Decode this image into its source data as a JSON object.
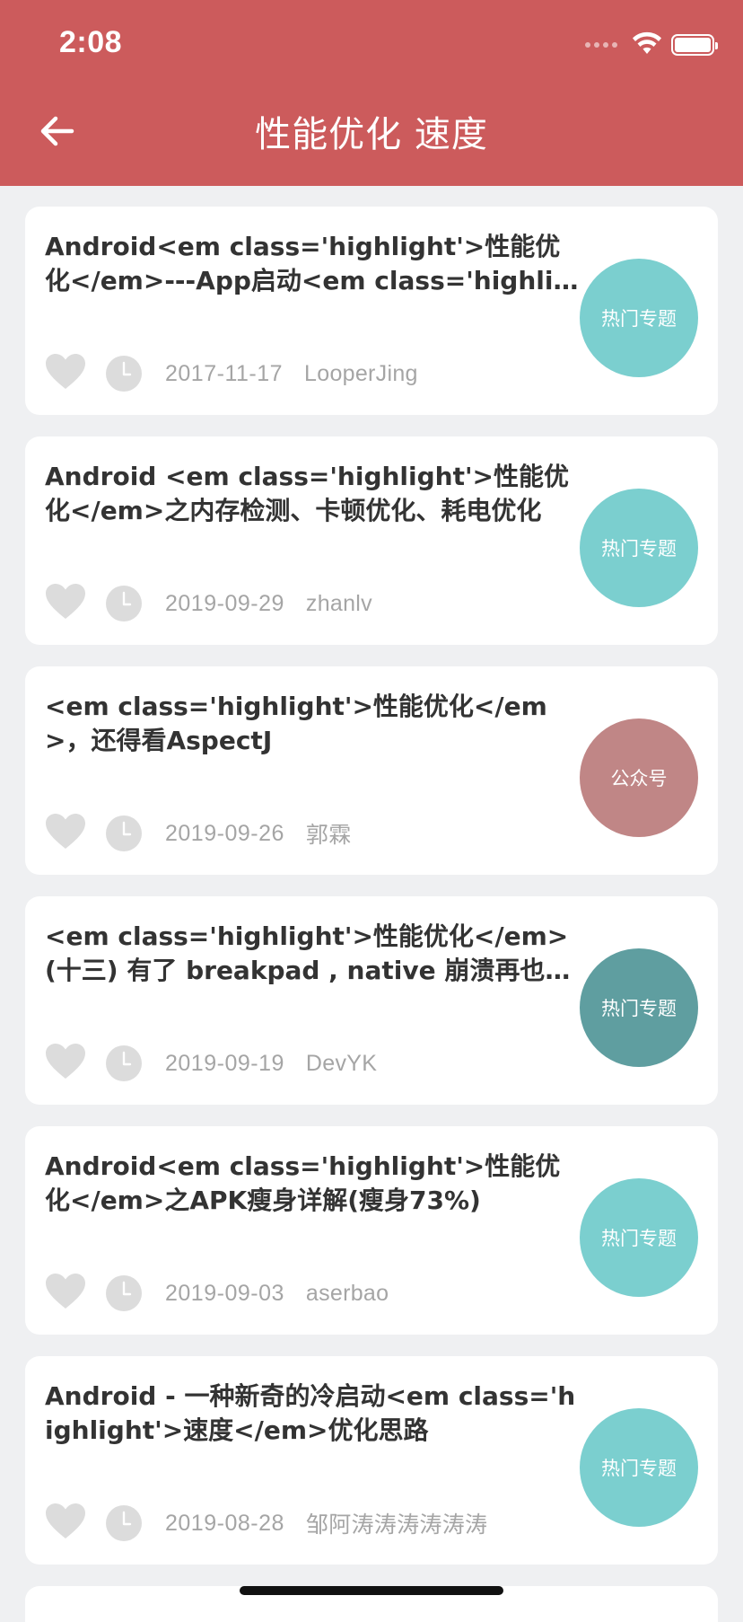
{
  "status_bar": {
    "time": "2:08"
  },
  "header": {
    "title": "性能优化 速度",
    "back_icon": "arrow-left-icon"
  },
  "colors": {
    "header_bg": "#cc5b5c",
    "page_bg": "#eff0f2",
    "tag_teal": "#7bcfcf",
    "tag_dark_teal": "#5f9ea0",
    "tag_rose": "#c08686"
  },
  "articles": [
    {
      "title": "Android<em class='highlight'>性能优化</em>---App启动<em class='highlight'>速度</em>优化",
      "date": "2017-11-17",
      "author": "LooperJing",
      "tag": "热门专题",
      "tag_color": "#7bcfcf"
    },
    {
      "title": "Android <em class='highlight'>性能优化</em>之内存检测、卡顿优化、耗电优化",
      "date": "2019-09-29",
      "author": "zhanlv",
      "tag": "热门专题",
      "tag_color": "#7bcfcf"
    },
    {
      "title": "<em class='highlight'>性能优化</em>，还得看AspectJ",
      "date": "2019-09-26",
      "author": "郭霖",
      "tag": "公众号",
      "tag_color": "#c08686"
    },
    {
      "title": "<em class='highlight'>性能优化</em>(十三) 有了 breakpad , native 崩溃再也不怕",
      "date": "2019-09-19",
      "author": "DevYK",
      "tag": "热门专题",
      "tag_color": "#5f9ea0"
    },
    {
      "title": "Android<em class='highlight'>性能优化</em>之APK瘦身详解(瘦身73%)",
      "date": "2019-09-03",
      "author": "aserbao",
      "tag": "热门专题",
      "tag_color": "#7bcfcf"
    },
    {
      "title": "Android - 一种新奇的冷启动<em class='highlight'>速度</em>优化思路",
      "date": "2019-08-28",
      "author": "邹阿涛涛涛涛涛涛",
      "tag": "热门专题",
      "tag_color": "#7bcfcf"
    }
  ]
}
